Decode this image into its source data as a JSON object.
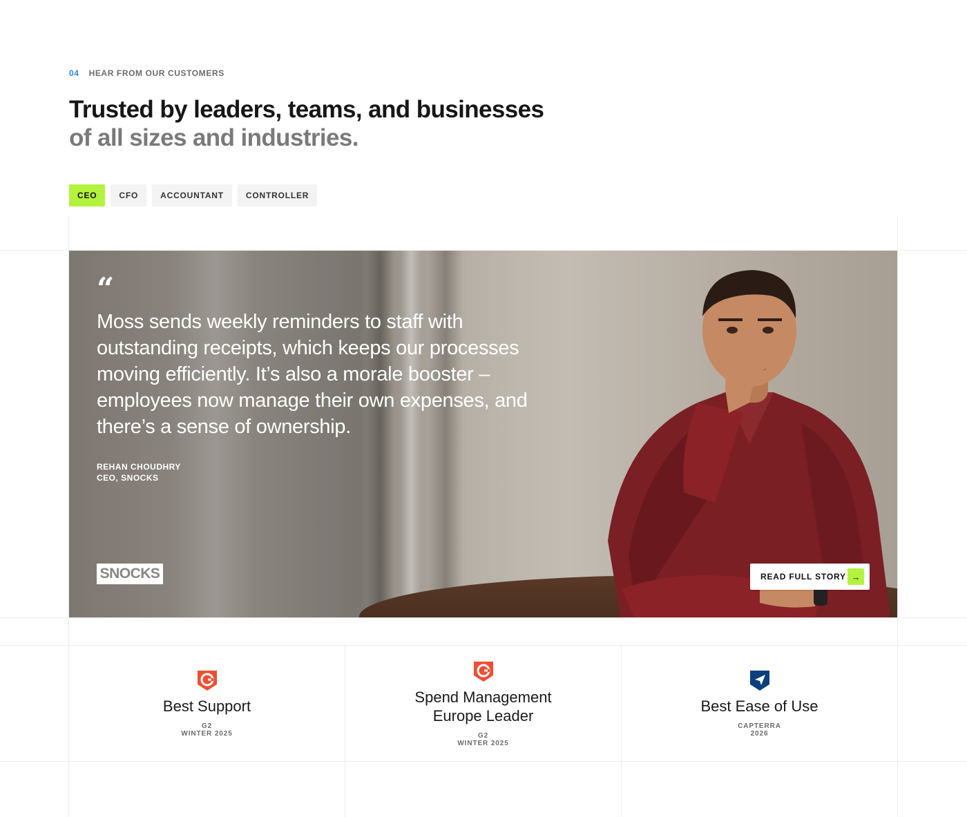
{
  "section": {
    "number": "04",
    "label": "HEAR FROM OUR CUSTOMERS"
  },
  "headline": {
    "line1": "Trusted by leaders, teams, and businesses",
    "line2": "of all sizes and industries."
  },
  "tabs": [
    {
      "label": "CEO",
      "active": true
    },
    {
      "label": "CFO",
      "active": false
    },
    {
      "label": "ACCOUNTANT",
      "active": false
    },
    {
      "label": "CONTROLLER",
      "active": false
    }
  ],
  "testimonial": {
    "quote": "Moss sends weekly reminders to staff with outstanding receipts, which keeps our processes moving efficiently. It’s also a morale booster – employees now manage their own expenses, and there’s a sense of ownership.",
    "author_name": "REHAN CHOUDHRY",
    "author_role": "CEO, SNOCKS",
    "company_logo": "SNOCKS",
    "cta_label": "READ FULL STORY"
  },
  "awards": [
    {
      "title": "Best Support",
      "source": "G2",
      "period": "WINTER 2025",
      "icon": "g2-badge-icon"
    },
    {
      "title": "Spend Management Europe Leader",
      "source": "G2",
      "period": "WINTER 2025",
      "icon": "g2-badge-icon"
    },
    {
      "title": "Best Ease of Use",
      "source": "CAPTERRA",
      "period": "2026",
      "icon": "capterra-badge-icon"
    }
  ],
  "colors": {
    "accent": "#b4f33d",
    "section_number": "#2d8ad8",
    "g2_red": "#ef4e32",
    "capterra_blue": "#0b3f7e"
  }
}
